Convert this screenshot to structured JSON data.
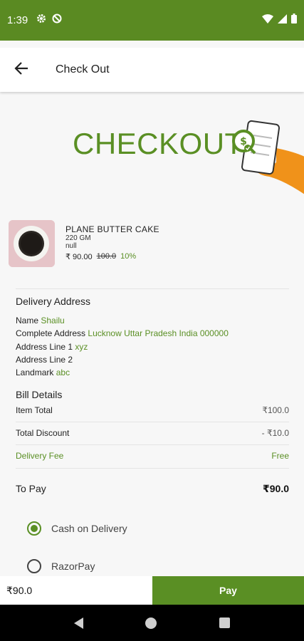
{
  "status": {
    "time": "1:39"
  },
  "appbar": {
    "title": "Check Out"
  },
  "banner": {
    "text": "CHECKOUT"
  },
  "product": {
    "name": "PLANE BUTTER CAKE",
    "weight": "220 GM",
    "note": "null",
    "price": "₹ 90.00",
    "old_price": "100.0",
    "discount": "10%"
  },
  "address": {
    "title": "Delivery Address",
    "rows": [
      {
        "label": "Name",
        "value": "Shailu"
      },
      {
        "label": "Complete Address",
        "value": "Lucknow Uttar Pradesh India 000000"
      },
      {
        "label": "Address Line 1",
        "value": "xyz"
      },
      {
        "label": "Address Line 2",
        "value": ""
      },
      {
        "label": "Landmark",
        "value": "abc"
      }
    ]
  },
  "bill": {
    "title": "Bill Details",
    "item_total": {
      "label": "Item Total",
      "value": "₹100.0"
    },
    "discount": {
      "label": "Total Discount",
      "value": "- ₹10.0"
    },
    "delivery": {
      "label": "Delivery Fee",
      "value": "Free"
    },
    "to_pay": {
      "label": "To Pay",
      "value": "₹90.0"
    }
  },
  "payment": {
    "options": [
      {
        "label": "Cash on Delivery",
        "selected": true
      },
      {
        "label": "RazorPay",
        "selected": false
      }
    ]
  },
  "bottom": {
    "total": "₹90.0",
    "pay_label": "Pay"
  },
  "colors": {
    "brand": "#5a8a22",
    "accent": "#5a8f24",
    "hand": "#f0921a"
  }
}
